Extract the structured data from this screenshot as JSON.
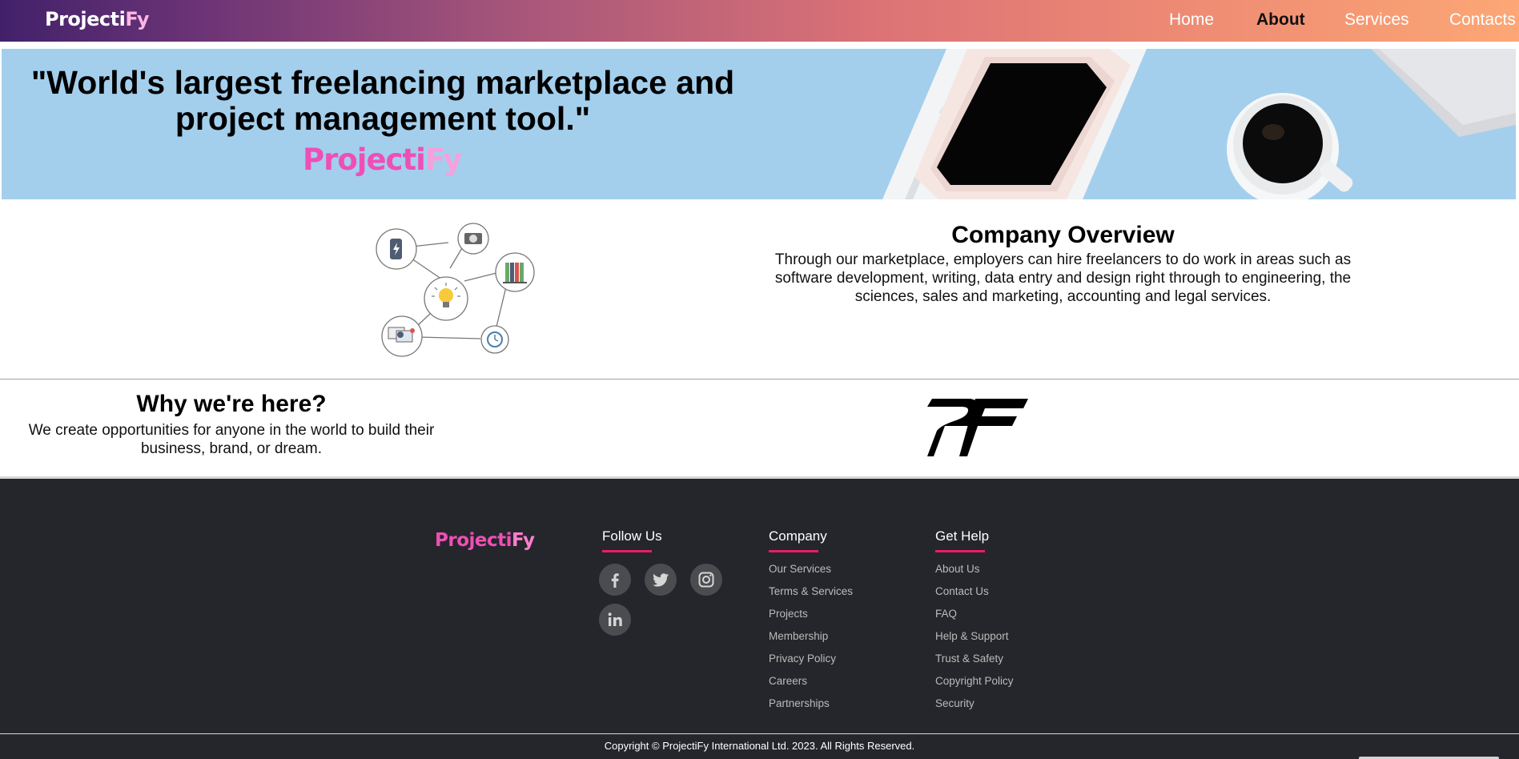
{
  "nav": {
    "brand_main": "Projecti",
    "brand_accent": "Fy",
    "links": [
      "Home",
      "About",
      "Services",
      "Contacts"
    ],
    "active": "About"
  },
  "hero": {
    "quote": "\"World's largest freelancing marketplace and project management tool.\"",
    "brand_main": "Projecti",
    "brand_accent": "Fy"
  },
  "overview": {
    "title": "Company Overview",
    "text": "Through our marketplace, employers can hire freelancers to do work in areas such as software development, writing, data entry and design right through to engineering, the sciences, sales and marketing, accounting and legal services."
  },
  "why": {
    "title": "Why we're here?",
    "text": "We create opportunities for anyone in the world to build their business, brand, or dream."
  },
  "footer": {
    "brand_main": "Projecti",
    "brand_accent": "Fy",
    "follow": {
      "heading": "Follow Us",
      "icons": [
        "facebook-icon",
        "twitter-icon",
        "instagram-icon",
        "linkedin-icon"
      ]
    },
    "company": {
      "heading": "Company",
      "items": [
        "Our Services",
        "Terms & Services",
        "Projects",
        "Membership",
        "Privacy Policy",
        "Careers",
        "Partnerships"
      ]
    },
    "help": {
      "heading": "Get Help",
      "items": [
        "About Us",
        "Contact Us",
        "FAQ",
        "Help & Support",
        "Trust & Safety",
        "Copyright Policy",
        "Security"
      ]
    },
    "copyright": "Copyright © ProjectiFy International Ltd. 2023. All Rights Reserved."
  },
  "colors": {
    "nav_gradient_start": "#42216a",
    "nav_gradient_end": "#fca775",
    "hero_bg": "#a3cfec",
    "brand_pink": "#ee4fb6",
    "footer_bg": "#24262b",
    "footer_accent": "#e91e63"
  }
}
